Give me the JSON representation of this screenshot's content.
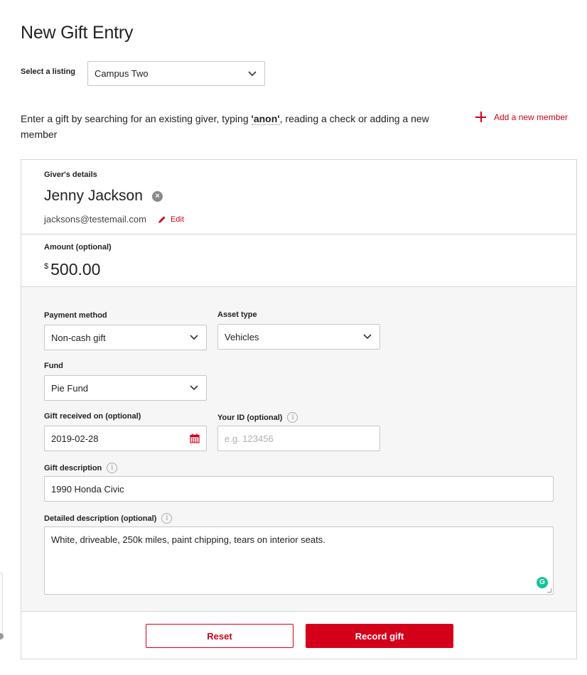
{
  "page": {
    "title": "New Gift Entry"
  },
  "listing": {
    "label": "Select a listing",
    "selected": "Campus Two"
  },
  "intro": {
    "text_before": "Enter a gift by searching for an existing giver, typing ",
    "anon": "'anon'",
    "text_after": ", reading a check or adding a new member"
  },
  "add_member": {
    "label": "Add a new member"
  },
  "giver": {
    "section_label": "Giver's details",
    "name": "Jenny Jackson",
    "email": "jacksons@testemail.com",
    "edit_label": "Edit"
  },
  "amount": {
    "label": "Amount (optional)",
    "currency": "$",
    "value": "500.00"
  },
  "form": {
    "payment_method": {
      "label": "Payment method",
      "value": "Non-cash gift"
    },
    "asset_type": {
      "label": "Asset type",
      "value": "Vehicles"
    },
    "fund": {
      "label": "Fund",
      "value": "Pie Fund"
    },
    "gift_received": {
      "label": "Gift received on (optional)",
      "value": "2019-02-28"
    },
    "your_id": {
      "label": "Your ID (optional)",
      "placeholder": "e.g. 123456"
    },
    "gift_description": {
      "label": "Gift description",
      "value": "1990 Honda Civic"
    },
    "detailed_description": {
      "label": "Detailed description (optional)",
      "value": "White, driveable, 250k miles, paint chipping, tears on interior seats."
    }
  },
  "actions": {
    "reset": "Reset",
    "record": "Record gift"
  },
  "colors": {
    "accent": "#d4001a",
    "form_bg": "#f6f6f6",
    "border": "#d6d6d6"
  },
  "icons": [
    "chevron-down-icon",
    "plus-icon",
    "clear-icon",
    "pencil-icon",
    "calendar-icon",
    "info-icon",
    "grammarly-icon"
  ]
}
